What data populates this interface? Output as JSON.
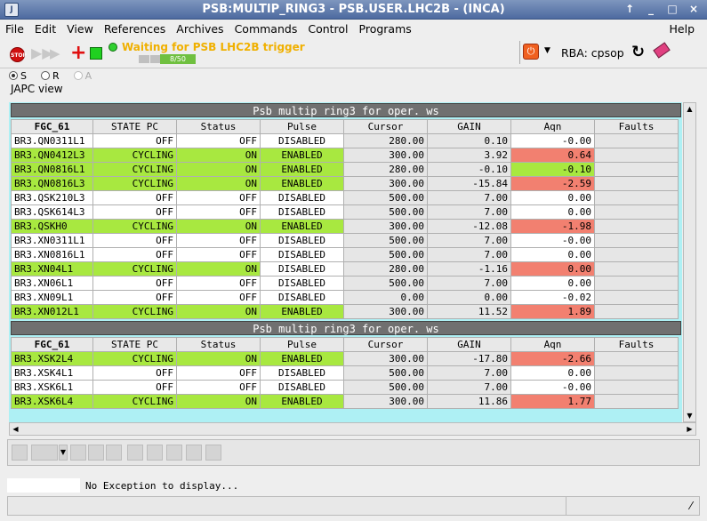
{
  "window": {
    "title": "PSB:MULTIP_RING3 - PSB.USER.LHC2B - (INCA)",
    "buttons": [
      "↑",
      "_",
      "□",
      "×"
    ]
  },
  "menu": [
    "File",
    "Edit",
    "View",
    "References",
    "Archives",
    "Commands",
    "Control",
    "Programs"
  ],
  "menu_help": "Help",
  "toolbar": {
    "stop_icon_text": "STOP",
    "status_text": "Waiting for PSB LHC2B trigger",
    "progress_text": "8/50",
    "progress": 0.16,
    "rba_label": "RBA: cpsop",
    "dropdown": "▼"
  },
  "options": {
    "s": "S",
    "r": "R",
    "a": "A",
    "view_label": "JAPC view"
  },
  "table1": {
    "title": "Psb multip ring3 for oper. ws",
    "columns": [
      "FGC_61",
      "STATE PC",
      "Status",
      "Pulse",
      "Cursor",
      "GAIN",
      "Aqn",
      "Faults"
    ],
    "rows": [
      [
        "BR3.QN0311L1",
        "OFF",
        "OFF",
        "DISABLED",
        "280.00",
        "0.10",
        "-0.00",
        ""
      ],
      [
        "BR3.QN0412L3",
        "CYCLING",
        "ON",
        "ENABLED",
        "300.00",
        "3.92",
        "0.64",
        ""
      ],
      [
        "BR3.QN0816L1",
        "CYCLING",
        "ON",
        "ENABLED",
        "280.00",
        "-0.10",
        "-0.10",
        ""
      ],
      [
        "BR3.QN0816L3",
        "CYCLING",
        "ON",
        "ENABLED",
        "300.00",
        "-15.84",
        "-2.59",
        ""
      ],
      [
        "BR3.QSK210L3",
        "OFF",
        "OFF",
        "DISABLED",
        "500.00",
        "7.00",
        "0.00",
        ""
      ],
      [
        "BR3.QSK614L3",
        "OFF",
        "OFF",
        "DISABLED",
        "500.00",
        "7.00",
        "0.00",
        ""
      ],
      [
        "BR3.QSKH0",
        "CYCLING",
        "ON",
        "ENABLED",
        "300.00",
        "-12.08",
        "-1.98",
        ""
      ],
      [
        "BR3.XN0311L1",
        "OFF",
        "OFF",
        "DISABLED",
        "500.00",
        "7.00",
        "-0.00",
        ""
      ],
      [
        "BR3.XN0816L1",
        "OFF",
        "OFF",
        "DISABLED",
        "500.00",
        "7.00",
        "0.00",
        ""
      ],
      [
        "BR3.XN04L1",
        "CYCLING",
        "ON",
        "DISABLED",
        "280.00",
        "-1.16",
        "0.00",
        ""
      ],
      [
        "BR3.XN06L1",
        "OFF",
        "OFF",
        "DISABLED",
        "500.00",
        "7.00",
        "0.00",
        ""
      ],
      [
        "BR3.XN09L1",
        "OFF",
        "OFF",
        "DISABLED",
        "0.00",
        "0.00",
        "-0.02",
        ""
      ],
      [
        "BR3.XN012L1",
        "CYCLING",
        "ON",
        "ENABLED",
        "300.00",
        "11.52",
        "1.89",
        ""
      ]
    ]
  },
  "table2": {
    "title": "Psb multip ring3 for oper. ws",
    "columns": [
      "FGC_61",
      "STATE PC",
      "Status",
      "Pulse",
      "Cursor",
      "GAIN",
      "Aqn",
      "Faults"
    ],
    "rows": [
      [
        "BR3.XSK2L4",
        "CYCLING",
        "ON",
        "ENABLED",
        "300.00",
        "-17.80",
        "-2.66",
        ""
      ],
      [
        "BR3.XSK4L1",
        "OFF",
        "OFF",
        "DISABLED",
        "500.00",
        "7.00",
        "0.00",
        ""
      ],
      [
        "BR3.XSK6L1",
        "OFF",
        "OFF",
        "DISABLED",
        "500.00",
        "7.00",
        "-0.00",
        ""
      ],
      [
        "BR3.XSK6L4",
        "CYCLING",
        "ON",
        "ENABLED",
        "300.00",
        "11.86",
        "1.77",
        ""
      ]
    ]
  },
  "status": {
    "message": "No Exception to display..."
  },
  "colors": {
    "green": "#a8e840",
    "red": "#f28070",
    "gray": "#e0e0e0",
    "accent": "#f0b000",
    "title": "#4d6aa0"
  }
}
